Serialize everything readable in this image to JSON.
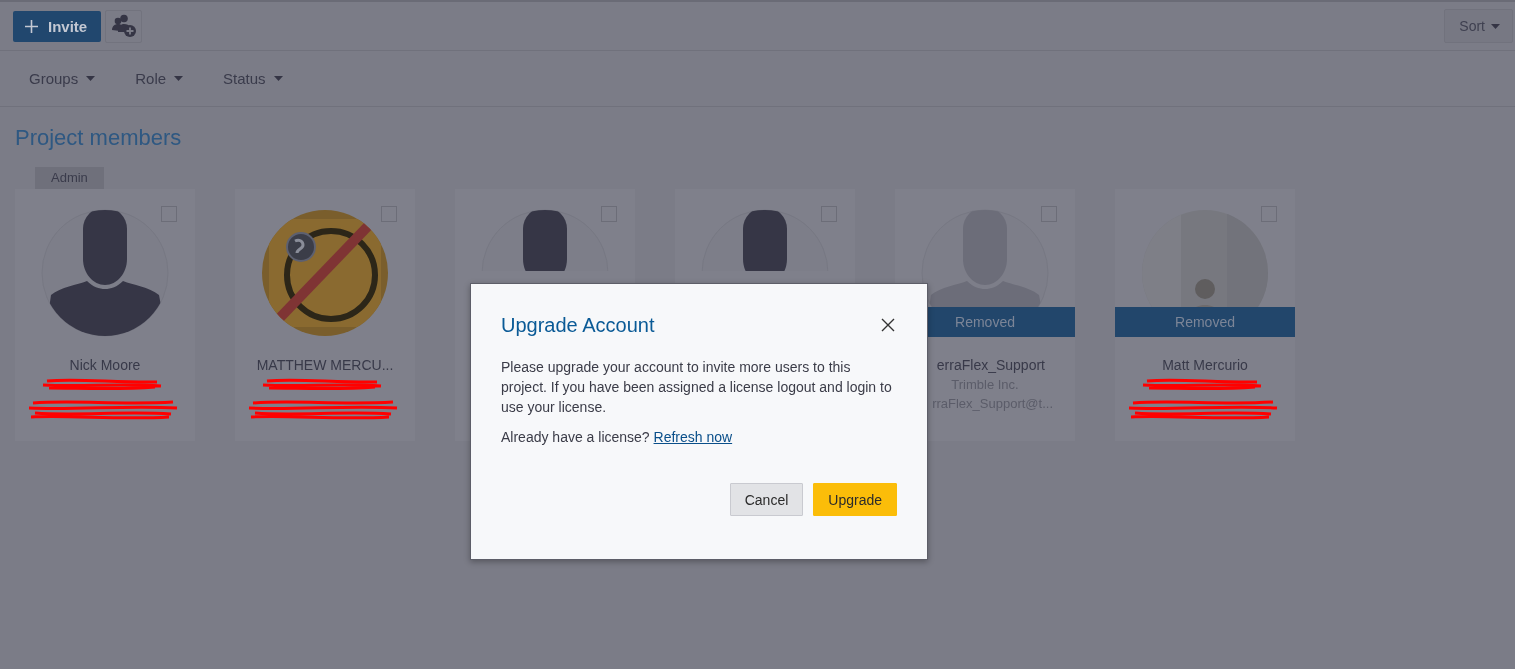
{
  "toolbar": {
    "invite_button": "Invite",
    "sort_button": "Sort"
  },
  "filters": [
    {
      "label": "Groups"
    },
    {
      "label": "Role"
    },
    {
      "label": "Status"
    }
  ],
  "section_title": "Project members",
  "members": [
    {
      "kind": "silhouette",
      "badge": "Admin",
      "name": "Nick Moore",
      "checked": false,
      "redacted": true
    },
    {
      "kind": "picture",
      "name": "MATTHEW MERCU...",
      "checked": false,
      "redacted": true
    },
    {
      "kind": "silhouette",
      "covered_below": true,
      "checked": false
    },
    {
      "kind": "silhouette",
      "covered_below": true,
      "checked": false
    },
    {
      "kind": "silhouette",
      "status": "Removed",
      "name": "erraFlex_Support",
      "company": "Trimble Inc.",
      "email": "rraFlex_Support@t...",
      "covered_left": true,
      "checked": false
    },
    {
      "kind": "picture",
      "status": "Removed",
      "name": "Matt Mercurio",
      "checked": false,
      "redacted": true
    }
  ],
  "dialog": {
    "title": "Upgrade Account",
    "body": "Please upgrade your account to invite more users to this project. If you have been assigned a license logout and login to use your license.",
    "prompt": "Already have a license?",
    "link": "Refresh now",
    "buttons": [
      {
        "label": "Cancel",
        "kind": "secondary"
      },
      {
        "label": "Upgrade",
        "kind": "primary"
      }
    ]
  }
}
